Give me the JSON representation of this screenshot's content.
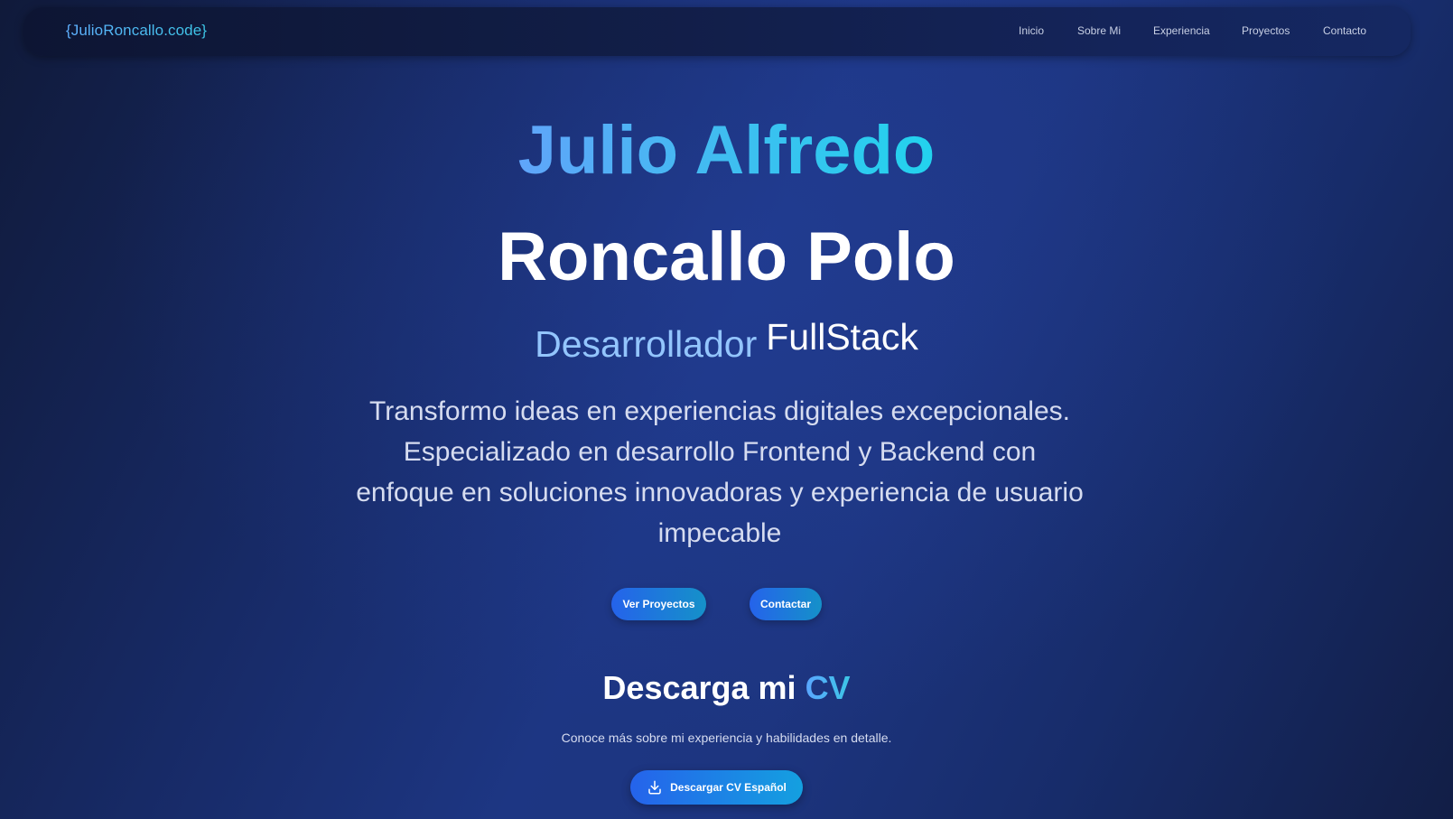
{
  "nav": {
    "brand": "{JulioRoncallo.code}",
    "links": [
      "Inicio",
      "Sobre Mi",
      "Experiencia",
      "Proyectos",
      "Contacto"
    ]
  },
  "hero": {
    "name_first": "Julio Alfredo",
    "name_last": "Roncallo Polo",
    "role_prefix": "Desarrollador",
    "role_suffix": "FullStack",
    "tagline": "Transformo ideas en experiencias digitales excepcionales. Especializado en desarrollo Frontend y Backend con enfoque en soluciones innovadoras y experiencia de usuario impecable",
    "buttons": {
      "projects": "Ver Proyectos",
      "contact": "Contactar"
    }
  },
  "cv": {
    "title_main": "Descarga mi",
    "title_accent": "CV",
    "subtitle": "Conoce más sobre mi experiencia y habilidades en detalle.",
    "download_label": "Descargar CV Español",
    "download_icon": "download-icon"
  },
  "colors": {
    "accent_blue": "#60a5fa",
    "accent_cyan": "#22d3ee",
    "button_start": "#2563eb",
    "button_end": "#1591c9",
    "background": "#1d3683"
  }
}
